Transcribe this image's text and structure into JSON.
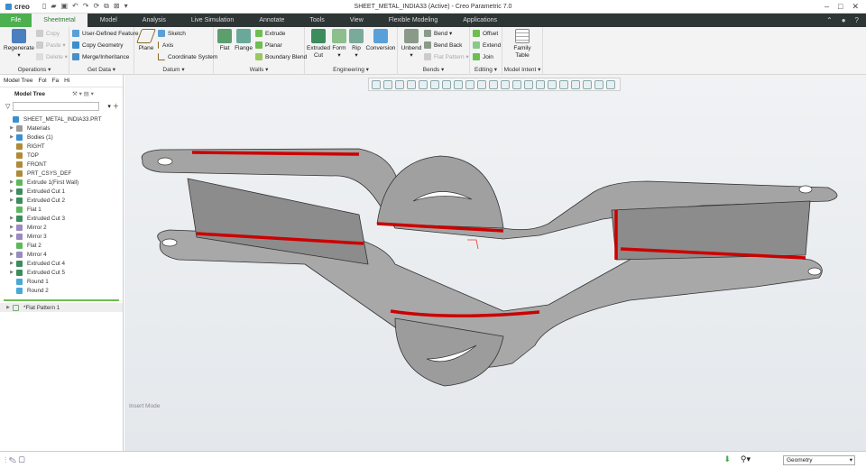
{
  "app": {
    "logo": "creo",
    "title": "SHEET_METAL_INDIA33 (Active) - Creo Parametric 7.0"
  },
  "tabs": [
    "File",
    "Sheetmetal",
    "Model",
    "Analysis",
    "Live Simulation",
    "Annotate",
    "Tools",
    "View",
    "Flexible Modeling",
    "Applications"
  ],
  "ribbon": {
    "operations": {
      "label": "Operations ▾",
      "regenerate": "Regenerate",
      "copy": "Copy",
      "paste": "Paste ▾",
      "delete": "Delete ▾"
    },
    "getdata": {
      "label": "Get Data ▾",
      "udf": "User-Defined Feature",
      "copygeom": "Copy Geometry",
      "merge": "Merge/Inheritance"
    },
    "datum": {
      "label": "Datum ▾",
      "plane": "Plane",
      "sketch": "Sketch",
      "axis": "Axis",
      "csys": "Coordinate System"
    },
    "walls": {
      "label": "Walls ▾",
      "flat": "Flat",
      "flange": "Flange",
      "extrude": "Extrude",
      "planar": "Planar",
      "boundary": "Boundary Blend"
    },
    "engineering": {
      "label": "Engineering ▾",
      "extcut": "Extruded Cut",
      "form": "Form",
      "rip": "Rip",
      "conversion": "Conversion"
    },
    "bends": {
      "label": "Bends ▾",
      "unbend": "Unbend",
      "bend": "Bend ▾",
      "bendback": "Bend Back",
      "flatpattern": "Flat Pattern ▾"
    },
    "editing": {
      "label": "Editing ▾",
      "offset": "Offset",
      "extend": "Extend",
      "join": "Join"
    },
    "intent": {
      "label": "Model Intent ▾",
      "family": "Family Table"
    }
  },
  "panel": {
    "tabs": [
      "Model Tree",
      "Fol",
      "Fa",
      "Hi"
    ],
    "header": "Model Tree",
    "filter_placeholder": ""
  },
  "tree": [
    {
      "label": "SHEET_METAL_INDIA33.PRT",
      "color": "#3a8fd0",
      "arrow": ""
    },
    {
      "label": "Materials",
      "color": "#999",
      "arrow": "▶"
    },
    {
      "label": "Bodies (1)",
      "color": "#3a8fd0",
      "arrow": "▶"
    },
    {
      "label": "RIGHT",
      "color": "#b08a3a",
      "arrow": ""
    },
    {
      "label": "TOP",
      "color": "#b08a3a",
      "arrow": ""
    },
    {
      "label": "FRONT",
      "color": "#b08a3a",
      "arrow": ""
    },
    {
      "label": "PRT_CSYS_DEF",
      "color": "#b08a3a",
      "arrow": ""
    },
    {
      "label": "Extrude 1(First Wall)",
      "color": "#5cb85c",
      "arrow": "▶"
    },
    {
      "label": "Extruded Cut 1",
      "color": "#3c8c5c",
      "arrow": "▶"
    },
    {
      "label": "Extruded Cut 2",
      "color": "#3c8c5c",
      "arrow": "▶"
    },
    {
      "label": "Flat 1",
      "color": "#5cb85c",
      "arrow": ""
    },
    {
      "label": "Extruded Cut 3",
      "color": "#3c8c5c",
      "arrow": "▶"
    },
    {
      "label": "Mirror 2",
      "color": "#9a8ac0",
      "arrow": "▶"
    },
    {
      "label": "Mirror 3",
      "color": "#9a8ac0",
      "arrow": "▶"
    },
    {
      "label": "Flat 2",
      "color": "#5cb85c",
      "arrow": ""
    },
    {
      "label": "Mirror 4",
      "color": "#9a8ac0",
      "arrow": "▶"
    },
    {
      "label": "Extruded Cut 4",
      "color": "#3c8c5c",
      "arrow": "▶"
    },
    {
      "label": "Extruded Cut 5",
      "color": "#3c8c5c",
      "arrow": "▶"
    },
    {
      "label": "Round 1",
      "color": "#4aa8d8",
      "arrow": ""
    },
    {
      "label": "Round 2",
      "color": "#4aa8d8",
      "arrow": ""
    }
  ],
  "flat_pattern": "*Flat Pattern 1",
  "viewport": {
    "mode": "Insert Mode"
  },
  "status": {
    "filter": "Geometry"
  }
}
